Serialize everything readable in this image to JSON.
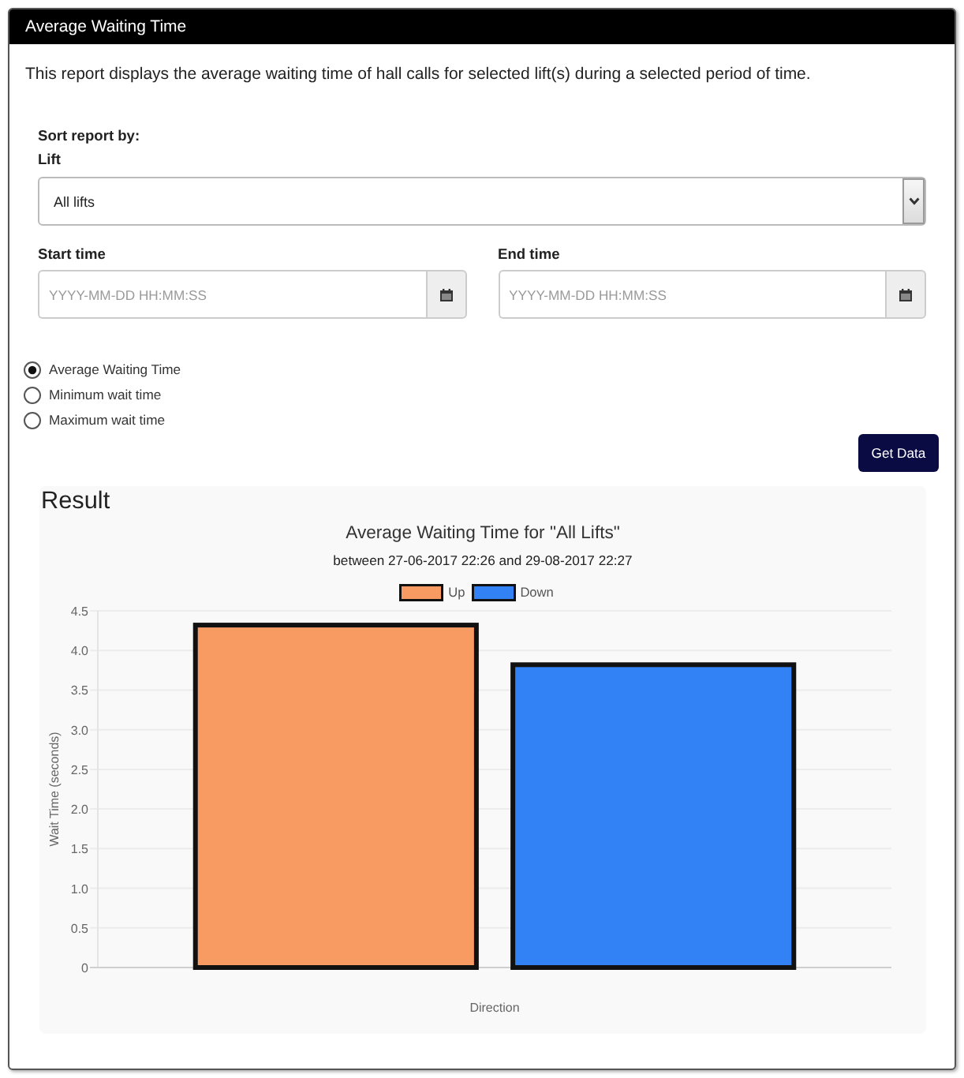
{
  "panel": {
    "title": "Average Waiting Time"
  },
  "description": "This report displays the average waiting time of hall calls for selected lift(s) during a selected period of time.",
  "sort": {
    "heading": "Sort report by:",
    "lift": {
      "label": "Lift",
      "value": "All lifts"
    },
    "start_time": {
      "label": "Start time",
      "placeholder": "YYYY-MM-DD HH:MM:SS"
    },
    "end_time": {
      "label": "End time",
      "placeholder": "YYYY-MM-DD HH:MM:SS"
    }
  },
  "report_types": [
    {
      "label": "Average Waiting Time",
      "selected": true
    },
    {
      "label": "Minimum wait time",
      "selected": false
    },
    {
      "label": "Maximum wait time",
      "selected": false
    }
  ],
  "get_data_button": "Get Data",
  "result": {
    "heading": "Result",
    "subtitle": "between 27-06-2017 22:26 and 29-08-2017 22:27",
    "chart_data": {
      "type": "bar",
      "title": "Average Waiting Time for \"All Lifts\"",
      "xlabel": "Direction",
      "ylabel": "Wait Time (seconds)",
      "legend": "top",
      "grid": true,
      "series": [
        {
          "name": "Up",
          "color": "#f89b63",
          "values": [
            4.32
          ]
        },
        {
          "name": "Down",
          "color": "#3282f6",
          "values": [
            3.82
          ]
        }
      ],
      "ylim": [
        0,
        4.5
      ],
      "yticks": [
        0,
        0.5,
        {
          "value": 1,
          "label": "1.0"
        },
        1.5,
        {
          "value": 2,
          "label": "2.0"
        },
        2.5,
        {
          "value": 3,
          "label": "3.0"
        },
        3.5,
        {
          "value": 4,
          "label": "4.0"
        },
        4.5
      ]
    }
  }
}
